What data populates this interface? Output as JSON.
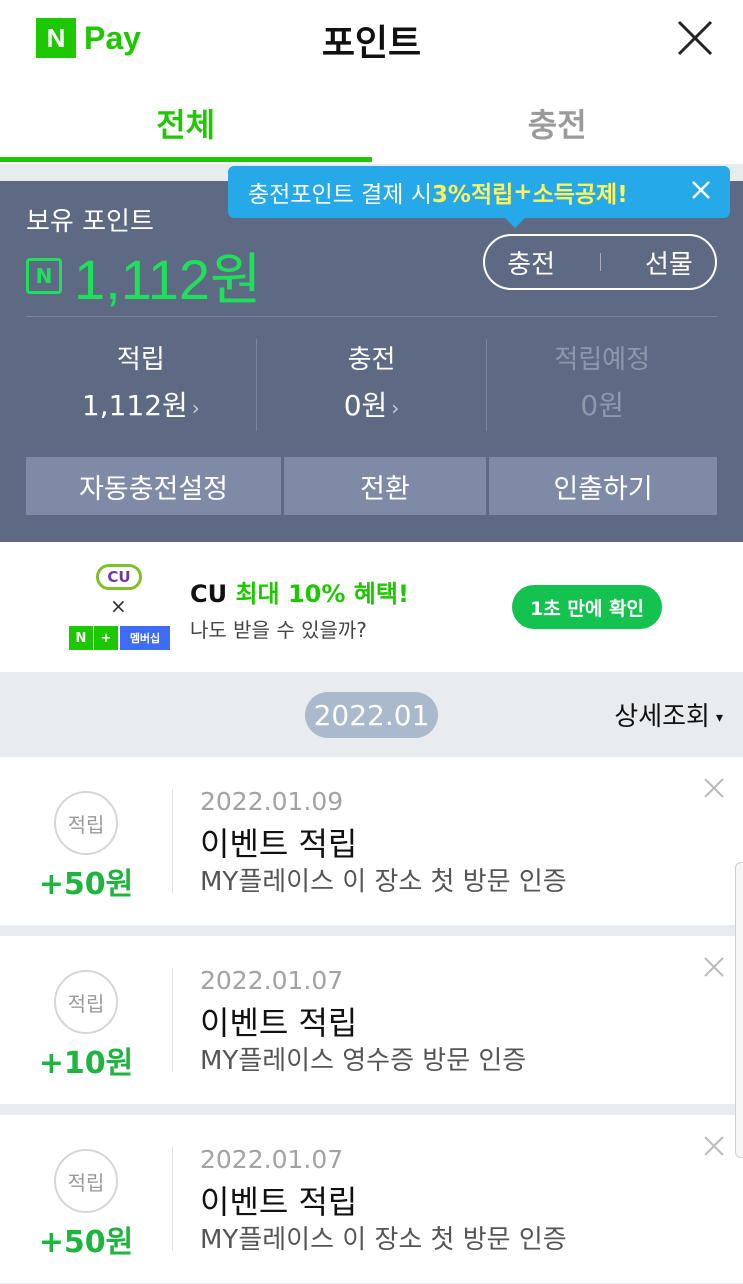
{
  "header": {
    "logo_n": "N",
    "logo_pay": "Pay",
    "title": "포인트"
  },
  "tabs": [
    {
      "label": "전체",
      "active": true
    },
    {
      "label": "충전",
      "active": false
    }
  ],
  "tooltip": {
    "text_prefix": "충전포인트 결제 시 ",
    "highlight": "3%적립",
    "plus": "+",
    "highlight2": "소득공제!"
  },
  "points": {
    "hold_label": "보유 포인트",
    "n_icon": "N",
    "hold_amount": "1,112원",
    "charge_label": "충전",
    "gift_label": "선물",
    "stats": [
      {
        "label": "적립",
        "value": "1,112원",
        "arrow": "›"
      },
      {
        "label": "충전",
        "value": "0원",
        "arrow": "›"
      },
      {
        "label": "적립예정",
        "value": "0원"
      }
    ],
    "actions": [
      "자동충전설정",
      "전환",
      "인출하기"
    ]
  },
  "banner": {
    "cu": "CU",
    "times": "×",
    "nplus": [
      "N",
      "+",
      "멤버십"
    ],
    "title_prefix": "CU ",
    "title_highlight": "최대 10% 혜택!",
    "subtitle": "나도 받을 수 있을까?",
    "button": "1초 만에 확인"
  },
  "month_bar": {
    "month": "2022.01",
    "detail": "상세조회",
    "detail_icon": "▾"
  },
  "items": [
    {
      "badge": "적립",
      "amount": "+50원",
      "date": "2022.01.09",
      "title": "이벤트 적립",
      "desc": "MY플레이스 이 장소 첫 방문 인증"
    },
    {
      "badge": "적립",
      "amount": "+10원",
      "date": "2022.01.07",
      "title": "이벤트 적립",
      "desc": "MY플레이스 영수증 방문 인증"
    },
    {
      "badge": "적립",
      "amount": "+50원",
      "date": "2022.01.07",
      "title": "이벤트 적립",
      "desc": "MY플레이스 이 장소 첫 방문 인증"
    }
  ],
  "colors": {
    "brand": "#1ec800",
    "panel": "#5e6a84",
    "tooltip": "#26a9e8",
    "points_green": "#1fe05b"
  }
}
